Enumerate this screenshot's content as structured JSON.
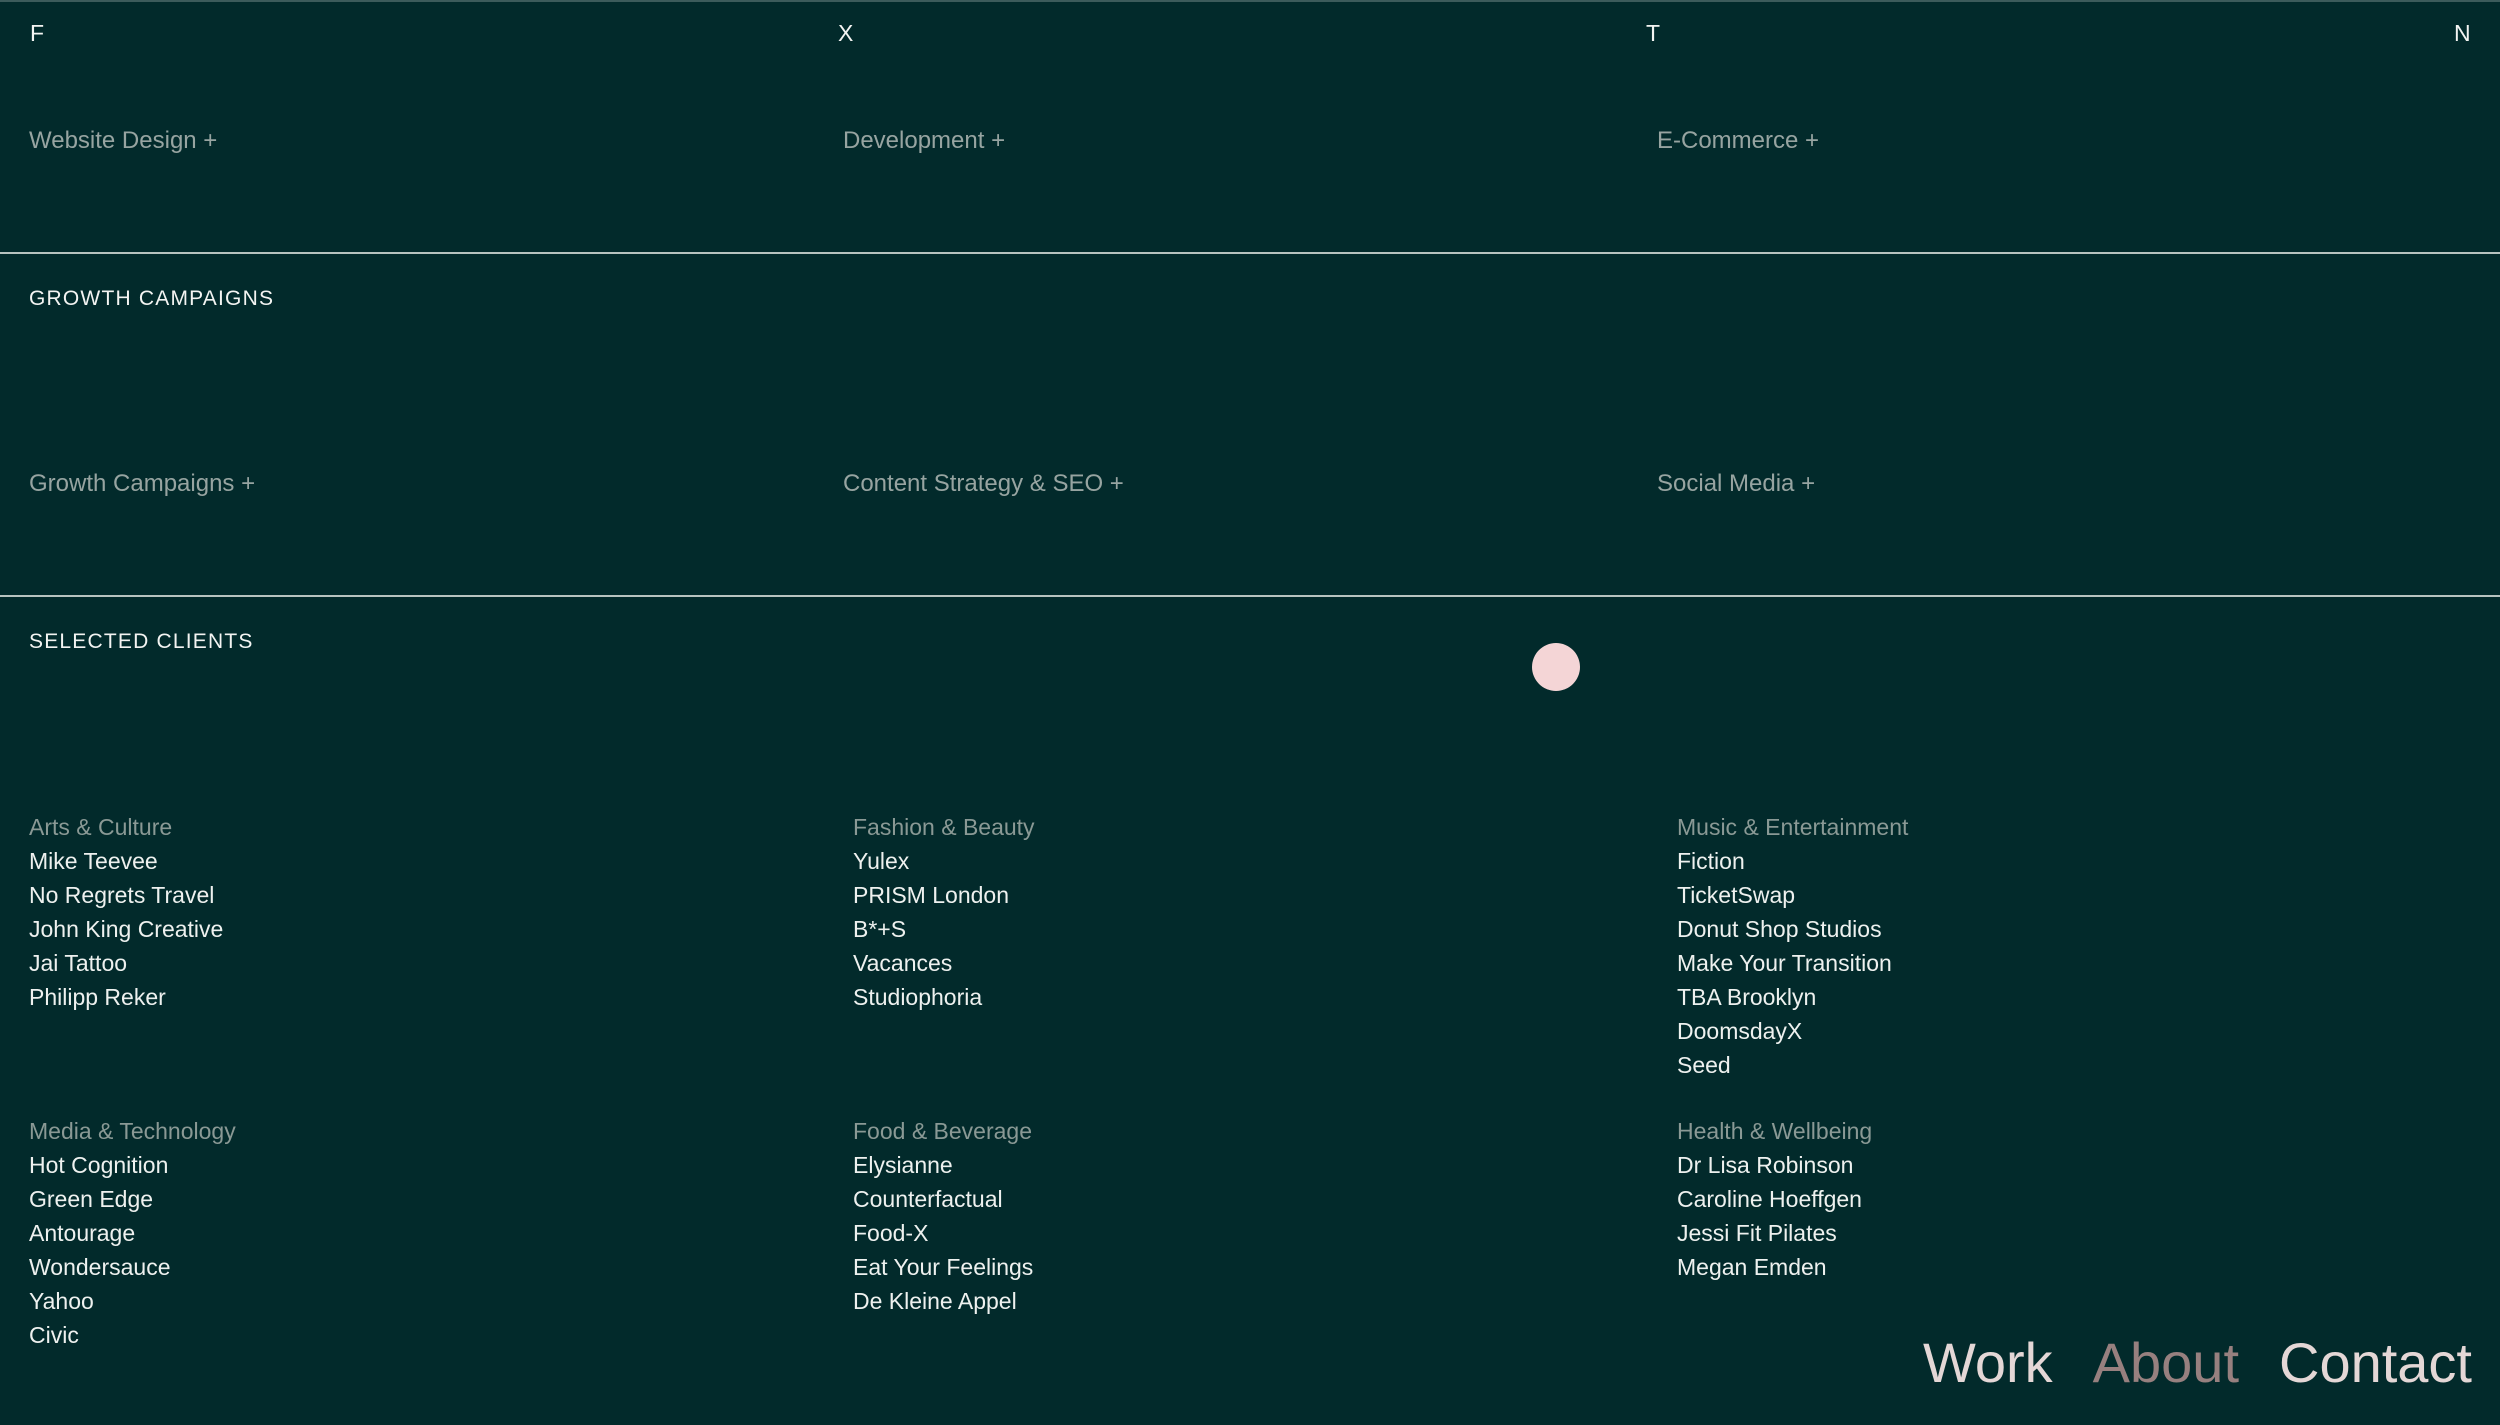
{
  "top_nav": {
    "letters": [
      "F",
      "X",
      "T",
      "N"
    ]
  },
  "services_web": {
    "items": [
      "Website Design +",
      "Development +",
      "E-Commerce +"
    ]
  },
  "growth": {
    "title": "GROWTH CAMPAIGNS",
    "items": [
      "Growth Campaigns +",
      "Content Strategy & SEO +",
      "Social Media +"
    ]
  },
  "clients": {
    "title": "SELECTED CLIENTS",
    "groups": [
      {
        "heading": "Arts & Culture",
        "items": [
          "Mike Teevee",
          "No Regrets Travel",
          "John King Creative",
          "Jai Tattoo",
          "Philipp Reker"
        ]
      },
      {
        "heading": "Fashion & Beauty",
        "items": [
          "Yulex",
          "PRISM London",
          "B*+S",
          "Vacances",
          "Studiophoria"
        ]
      },
      {
        "heading": "Music & Entertainment",
        "items": [
          "Fiction",
          "TicketSwap",
          "Donut Shop Studios",
          "Make Your Transition",
          "TBA Brooklyn",
          "DoomsdayX",
          "Seed"
        ]
      },
      {
        "heading": "Media & Technology",
        "items": [
          "Hot Cognition",
          "Green Edge",
          "Antourage",
          "Wondersauce",
          "Yahoo",
          "Civic"
        ]
      },
      {
        "heading": "Food & Beverage",
        "items": [
          "Elysianne",
          "Counterfactual",
          "Food-X",
          "Eat Your Feelings",
          "De Kleine Appel"
        ]
      },
      {
        "heading": "Health & Wellbeing",
        "items": [
          "Dr Lisa Robinson",
          "Caroline Hoeffgen",
          "Jessi Fit Pilates",
          "Megan Emden"
        ]
      }
    ]
  },
  "bottom_nav": {
    "work": "Work",
    "about": "About",
    "contact": "Contact"
  },
  "colors": {
    "background": "#022a2b",
    "muted_text": "#97a4a1",
    "cursor_dot": "#f4d5d6",
    "nav_active": "#e4d7d6",
    "nav_muted": "#97807f"
  }
}
